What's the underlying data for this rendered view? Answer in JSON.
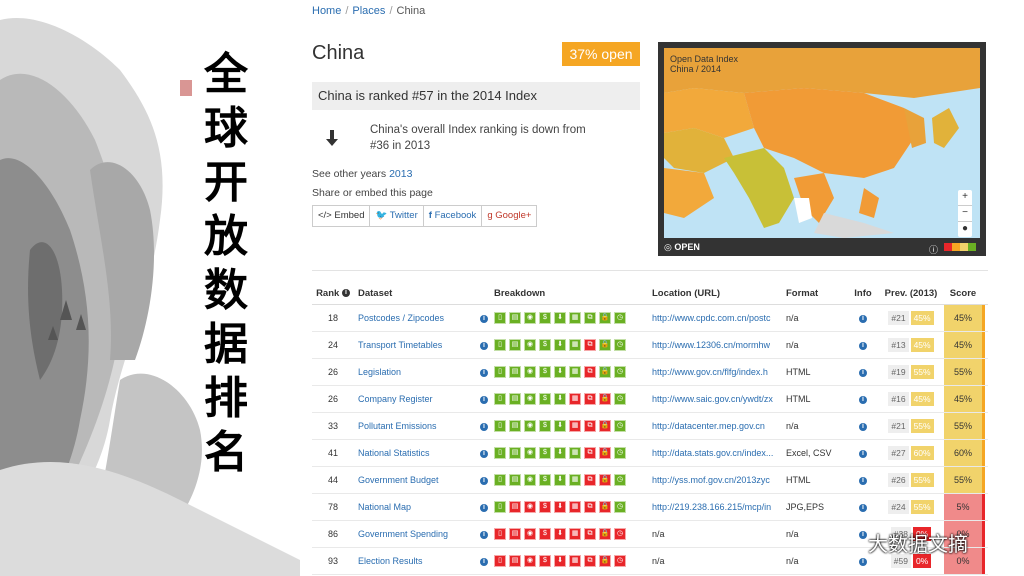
{
  "side_title": [
    "全",
    "球",
    "开",
    "放",
    "数",
    "据",
    "排",
    "名"
  ],
  "breadcrumb": {
    "home": "Home",
    "places": "Places",
    "current": "China"
  },
  "country": {
    "name": "China",
    "open_badge": "37% open",
    "rank_text": "China is ranked #57 in the 2014 Index",
    "down_text": "China's overall Index ranking is down from #36 in 2013",
    "see_other_prefix": "See other years",
    "see_other_year": "2013",
    "share_label": "Share or embed this page"
  },
  "share_buttons": [
    {
      "icon": "embed-icon",
      "label": "</> Embed"
    },
    {
      "icon": "twitter-icon",
      "label": "Twitter"
    },
    {
      "icon": "facebook-icon",
      "label": "Facebook"
    },
    {
      "icon": "google-plus-icon",
      "label": "Google+"
    }
  ],
  "map": {
    "logo_line1": "Open Data Index",
    "logo_line2": "China / 2014",
    "footer": "OPEN",
    "zoom_in": "+",
    "zoom_out": "−"
  },
  "table": {
    "headers": {
      "rank": "Rank",
      "dataset": "Dataset",
      "breakdown": "Breakdown",
      "location": "Location (URL)",
      "format": "Format",
      "info": "Info",
      "prev": "Prev. (2013)",
      "score": "Score"
    },
    "rows": [
      {
        "rank": "18",
        "dataset": "Postcodes / Zipcodes",
        "location": "http://www.cpdc.com.cn/postc",
        "format": "n/a",
        "prev_rank": "#21",
        "prev_pct": "45%",
        "score": "45%",
        "breakdown": "GGGGGGGGG"
      },
      {
        "rank": "24",
        "dataset": "Transport Timetables",
        "location": "http://www.12306.cn/mormhw",
        "format": "n/a",
        "prev_rank": "#13",
        "prev_pct": "45%",
        "score": "45%",
        "breakdown": "GGGGGGRGG"
      },
      {
        "rank": "26",
        "dataset": "Legislation",
        "location": "http://www.gov.cn/flfg/index.h",
        "format": "HTML",
        "prev_rank": "#19",
        "prev_pct": "55%",
        "score": "55%",
        "breakdown": "GGGGGGRGG"
      },
      {
        "rank": "26",
        "dataset": "Company Register",
        "location": "http://www.saic.gov.cn/ywdt/zx",
        "format": "HTML",
        "prev_rank": "#16",
        "prev_pct": "45%",
        "score": "45%",
        "breakdown": "GGGGGRRRG"
      },
      {
        "rank": "33",
        "dataset": "Pollutant Emissions",
        "location": "http://datacenter.mep.gov.cn",
        "format": "n/a",
        "prev_rank": "#21",
        "prev_pct": "55%",
        "score": "55%",
        "breakdown": "GGGGGRRRG"
      },
      {
        "rank": "41",
        "dataset": "National Statistics",
        "location": "http://data.stats.gov.cn/index...",
        "format": "Excel, CSV",
        "prev_rank": "#27",
        "prev_pct": "60%",
        "score": "60%",
        "breakdown": "GGGGGGRRG"
      },
      {
        "rank": "44",
        "dataset": "Government Budget",
        "location": "http://yss.mof.gov.cn/2013zyc",
        "format": "HTML",
        "prev_rank": "#26",
        "prev_pct": "55%",
        "score": "55%",
        "breakdown": "GGGGGGRRG"
      },
      {
        "rank": "78",
        "dataset": "National Map",
        "location": "http://219.238.166.215/mcp/in",
        "format": "JPG,EPS",
        "prev_rank": "#24",
        "prev_pct": "55%",
        "score": "5%",
        "breakdown": "GRRRRRRRG"
      },
      {
        "rank": "86",
        "dataset": "Government Spending",
        "location": "n/a",
        "format": "n/a",
        "prev_rank": "#38",
        "prev_pct": "0%",
        "score": "0%",
        "breakdown": "RRRRRRRRR"
      },
      {
        "rank": "93",
        "dataset": "Election Results",
        "location": "n/a",
        "format": "n/a",
        "prev_rank": "#59",
        "prev_pct": "0%",
        "score": "0%",
        "breakdown": "RRRRRRRRR"
      }
    ]
  },
  "colors": {
    "green": "#6ab023",
    "red": "#e8262a",
    "orange": "#f5a623",
    "yellow": "#f1d36b",
    "link": "#2a6db0"
  },
  "watermark": "大数据文摘"
}
